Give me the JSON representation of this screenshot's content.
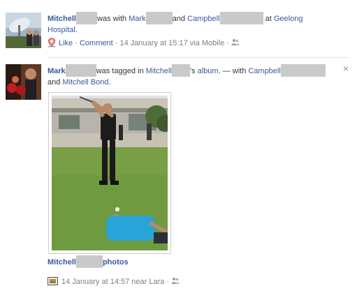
{
  "story1": {
    "actor": "Mitchell",
    "text_with": "was with",
    "friend1": "Mark",
    "text_and": "and",
    "friend2": "Campbell",
    "text_at": "at",
    "place_line1": "Geelong",
    "place_line2": "Hospital",
    "period": ".",
    "like": "Like",
    "comment": "Comment",
    "dot": "·",
    "timestamp": "14 January at 15:17 via Mobile",
    "privacy_icon": "friends-icon",
    "location_icon": "map-pin-icon"
  },
  "story2": {
    "actor": "Mark",
    "text_tagged": "was tagged in",
    "album_owner": "Mitchell",
    "text_album_possessive": "'s",
    "album_word": "album",
    "text_with": ". — with",
    "friend1": "Campbell",
    "text_and": "and",
    "friend2": "Mitchell Bond",
    "period": ".",
    "close_glyph": "×",
    "album_link_name": "Mitchell",
    "album_link_suffix": "photos",
    "timestamp": "14 January at 14:57 near Lara",
    "dot": "·",
    "privacy_icon": "friends-icon",
    "photo_icon": "photo-album-icon"
  },
  "colors": {
    "link": "#3b5998",
    "meta": "#7f7f7f",
    "redaction": "#c9c9c9",
    "divider": "#e5e5e5"
  }
}
